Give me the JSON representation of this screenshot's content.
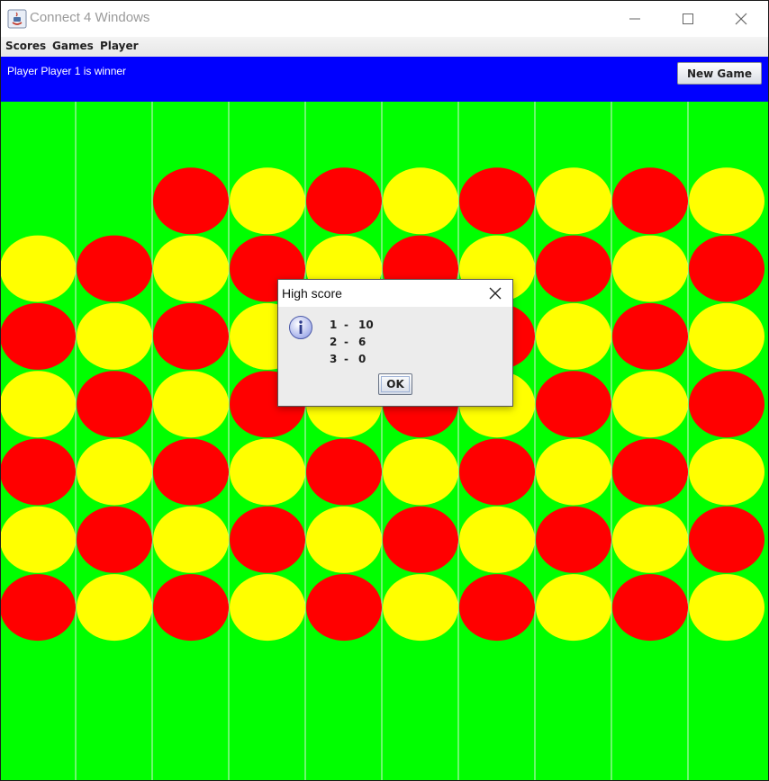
{
  "window": {
    "title": "Connect 4 Windows",
    "controls": {
      "minimize_icon": "minimize-icon",
      "maximize_icon": "maximize-icon",
      "close_icon": "close-icon"
    }
  },
  "menu": {
    "items": [
      {
        "label": "Scores"
      },
      {
        "label": "Games"
      },
      {
        "label": "Player"
      }
    ]
  },
  "status": {
    "message": "Player Player 1 is winner",
    "new_game_label": "New Game",
    "background_color": "#0000ff"
  },
  "board": {
    "background_color": "#00ff00",
    "colors": {
      "R": "#ff0000",
      "Y": "#ffff00"
    },
    "rows": [
      "..........",
      "..RYRYRYRY",
      "YRYRYRYRYR",
      "RYRYRYRYRY",
      "YRYRYRYRYR",
      "RYRYRYRYRY",
      "YRYRYRYRYR",
      "RYRYRYRYRY"
    ]
  },
  "dialog": {
    "title": "High score",
    "icon": "info-icon",
    "scores": [
      {
        "rank": "1",
        "sep": "-",
        "value": "10"
      },
      {
        "rank": "2",
        "sep": "-",
        "value": "6"
      },
      {
        "rank": "3",
        "sep": "-",
        "value": "0"
      }
    ],
    "ok_label": "OK"
  }
}
